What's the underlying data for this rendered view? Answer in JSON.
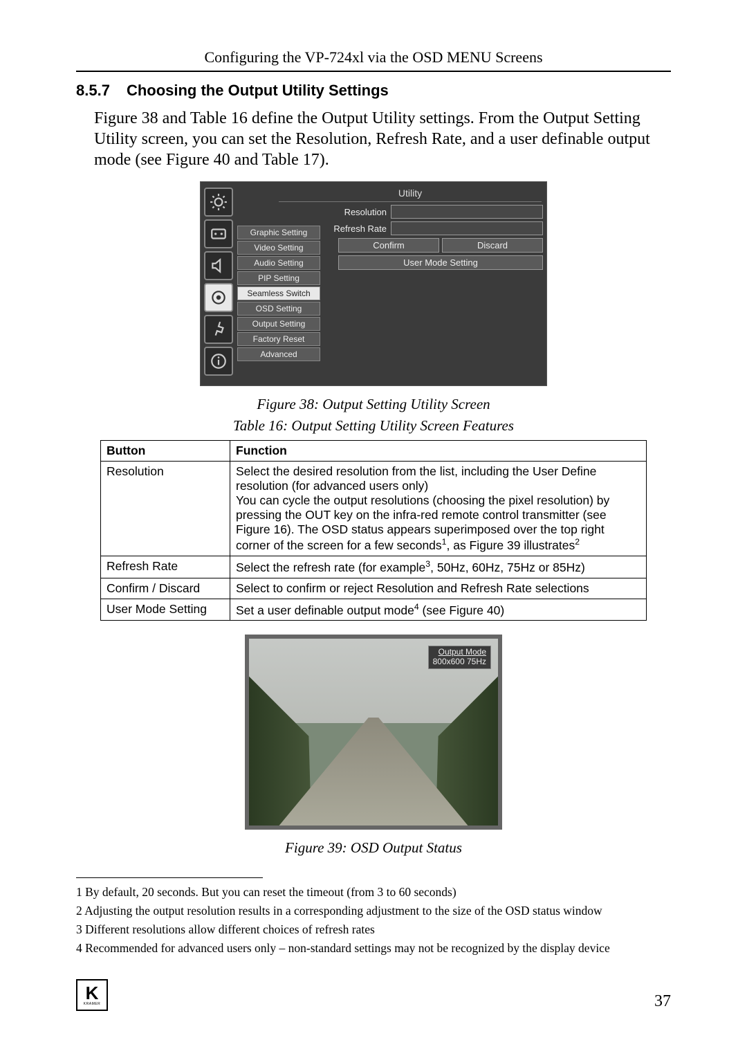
{
  "header": "Configuring the VP-724xl via the OSD MENU Screens",
  "section": {
    "number": "8.5.7",
    "title": "Choosing the Output Utility Settings"
  },
  "paragraph": "Figure 38 and Table 16 define the Output Utility settings. From the Output Setting Utility screen, you can set the Resolution, Refresh Rate, and a user definable output mode (see Figure 40 and Table 17).",
  "fig38": {
    "caption": "Figure 38: Output Setting Utility Screen",
    "title": "Utility",
    "menu": [
      "Graphic Setting",
      "Video Setting",
      "Audio Setting",
      "PIP Setting",
      "Seamless Switch",
      "OSD Setting",
      "Output Setting",
      "Factory Reset",
      "Advanced"
    ],
    "fields": {
      "resolution": "Resolution",
      "refresh": "Refresh Rate"
    },
    "buttons": {
      "confirm": "Confirm",
      "discard": "Discard",
      "user_mode": "User Mode Setting"
    }
  },
  "table16": {
    "caption": "Table 16: Output Setting Utility Screen Features",
    "head": [
      "Button",
      "Function"
    ],
    "rows": [
      {
        "button": "Resolution",
        "function": "Select the desired resolution from the list, including the User Define resolution (for advanced users only)\nYou can cycle the output resolutions (choosing the pixel resolution) by pressing the OUT key on the infra-red remote control transmitter (see Figure 16). The OSD status appears superimposed over the top right corner of the screen for a few seconds¹, as Figure 39 illustrates²"
      },
      {
        "button": "Refresh Rate",
        "function": "Select the refresh rate (for example³, 50Hz, 60Hz, 75Hz or 85Hz)"
      },
      {
        "button": "Confirm / Discard",
        "function": "Select to confirm or reject Resolution and Refresh Rate selections"
      },
      {
        "button": "User Mode Setting",
        "function": "Set a user definable output mode⁴ (see Figure 40)"
      }
    ]
  },
  "fig39": {
    "caption": "Figure 39: OSD Output Status",
    "status_title": "Output Mode",
    "status_value": "800x600   75Hz"
  },
  "footnotes": [
    "1 By default, 20 seconds. But you can reset the timeout (from 3 to 60 seconds)",
    "2 Adjusting the output resolution results in a corresponding adjustment to the size of the OSD status window",
    "3 Different resolutions allow different choices of refresh rates",
    "4 Recommended for advanced users only – non-standard settings may not be recognized by the display device"
  ],
  "footer": {
    "logo_text": "K",
    "logo_sub": "KRAMER",
    "page_number": "37"
  }
}
